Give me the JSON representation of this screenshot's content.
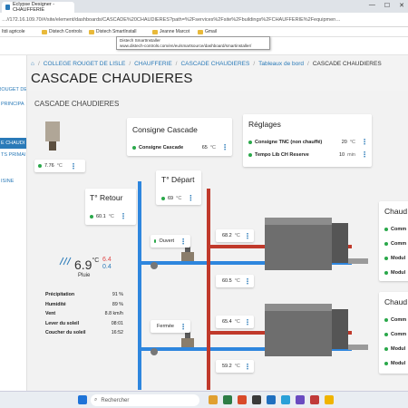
{
  "browser": {
    "tab_title": "Eclypse Designer - CHAUFFERIE",
    "url": "…//172.16.109.70/#/site/element/dashboards/CASCADE%20CHAUDIERES?path=%2Fservices%2Fsite%2Fbuildings%2FCHAUFFERIE%2Fequipmen…",
    "bookmarks": [
      "Itdi agricole",
      "Distech Controls",
      "Distech SmartInstall",
      "Jeanne Marcot",
      "Gmail"
    ],
    "tooltip_line1": "Distech SmartInstaller",
    "tooltip_line2": "www.distech-controls.com/en/eu/smartsource/dashboard/smartinstaller/"
  },
  "sidebar": {
    "items": [
      "ROUGET DE",
      "PRINCIPA",
      "E CHAUDI",
      "TS PRIMAII",
      "ISINE"
    ]
  },
  "breadcrumb": [
    "COLLEGE ROUGET DE LISLE",
    "CHAUFFERIE",
    "CASCADE CHAUDIERES",
    "Tableaux de bord",
    "CASCADE CHAUDIERES"
  ],
  "page_title": "CASCADE CHAUDIERES",
  "section_label": "CASCADE CHAUDIERES",
  "outdoor_sensor": {
    "value": "7.76",
    "unit": "°C"
  },
  "consigne_cascade": {
    "title": "Consigne Cascade",
    "label": "Consigne Cascade",
    "value": "65",
    "unit": "°C"
  },
  "reglages": {
    "title": "Réglages",
    "rows": [
      {
        "label": "Consigne TNC (non chauffé)",
        "value": "20",
        "unit": "°C"
      },
      {
        "label": "Tempo Lib CH Reserve",
        "value": "10",
        "unit": "min"
      }
    ]
  },
  "t_depart": {
    "title": "T° Départ",
    "value": "69",
    "unit": "°C"
  },
  "t_retour": {
    "title": "T° Retour",
    "value": "60.1",
    "unit": "°C"
  },
  "valve_top": {
    "state": "Ouvert"
  },
  "valve_bottom": {
    "state": "Fermée"
  },
  "boiler1": {
    "supply": "68.2",
    "return": "60.5",
    "unit": "°C"
  },
  "boiler2": {
    "supply": "65.4",
    "return": "59.2",
    "unit": "°C"
  },
  "chaud_panels": {
    "title": "Chaud",
    "rows": [
      "Comm",
      "Comm",
      "Modul",
      "Modul"
    ]
  },
  "weather": {
    "temp": "6.9",
    "deg": "°C",
    "hi": "6.4",
    "lo": "0.4",
    "desc": "Pluie",
    "rows": [
      {
        "k": "Précipitation",
        "v": "91 %"
      },
      {
        "k": "Humidité",
        "v": "89 %"
      },
      {
        "k": "Vent",
        "v": "8.8 km/h"
      },
      {
        "k": "Lever du soleil",
        "v": "08:01"
      },
      {
        "k": "Coucher du soleil",
        "v": "16:52"
      }
    ]
  },
  "taskbar": {
    "search_placeholder": "Rechercher"
  },
  "colors": {
    "accent": "#2a7ab8",
    "supply_pipe": "#c0392b",
    "return_pipe": "#2e86de",
    "status_ok": "#2aa84a"
  }
}
